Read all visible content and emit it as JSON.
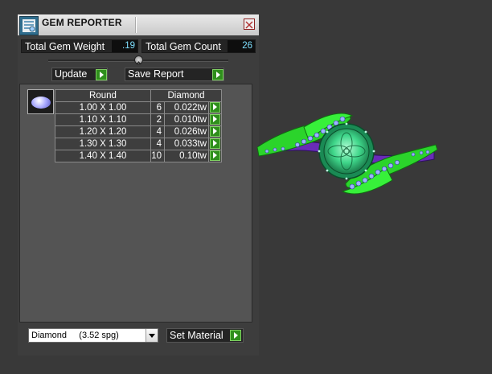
{
  "window": {
    "title": "GEM REPORTER"
  },
  "stats": {
    "weight_label": "Total Gem Weight",
    "weight_value": ".19",
    "count_label": "Total Gem Count",
    "count_value": "26"
  },
  "actions": {
    "update_label": "Update",
    "save_label": "Save Report",
    "set_material_label": "Set Material"
  },
  "table": {
    "headers": [
      "Round",
      "Diamond"
    ],
    "rows": [
      {
        "size": "1.00 X 1.00",
        "count": "6",
        "weight": "0.022tw"
      },
      {
        "size": "1.10 X 1.10",
        "count": "2",
        "weight": "0.010tw"
      },
      {
        "size": "1.20 X 1.20",
        "count": "4",
        "weight": "0.026tw"
      },
      {
        "size": "1.30 X 1.30",
        "count": "4",
        "weight": "0.033tw"
      },
      {
        "size": "1.40 X 1.40",
        "count": "10",
        "weight": "0.10tw"
      }
    ]
  },
  "material": {
    "selected": "Diamond     (3.52 spg)"
  },
  "colors": {
    "accent_green": "#2f8f1c",
    "value_cyan": "#7fe0ff",
    "ring_green": "#2bd42b",
    "gem_blue": "#8fa8ff",
    "band_purple": "#6a2bb8"
  },
  "icons": [
    "app-icon",
    "close-icon",
    "gem-thumbnail-icon",
    "play-arrow-icon",
    "dropdown-arrow-icon"
  ]
}
